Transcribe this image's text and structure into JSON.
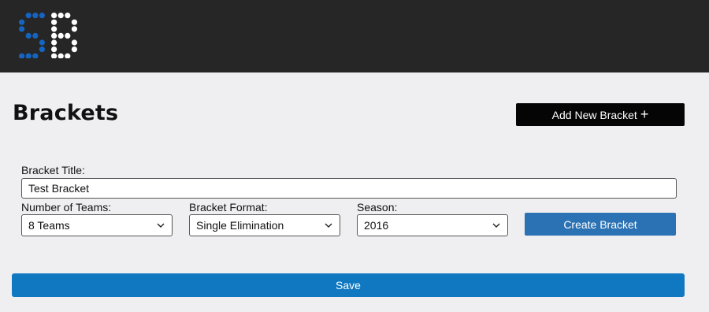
{
  "header": {
    "logo_icon": "sb-dot-matrix-logo-icon",
    "logo_text": "SB",
    "colors": {
      "background": "#262626",
      "logo_blue": "#1565c0",
      "logo_white": "#ffffff"
    }
  },
  "page": {
    "title": "Brackets"
  },
  "actions": {
    "add_new_label": "Add New Bracket",
    "add_new_icon": "plus-icon"
  },
  "form": {
    "title_label": "Bracket Title:",
    "title_value": "Test Bracket",
    "teams_label": "Number of Teams:",
    "teams_value": "8 Teams",
    "format_label": "Bracket Format:",
    "format_value": "Single Elimination",
    "season_label": "Season:",
    "season_value": "2016",
    "create_label": "Create Bracket"
  },
  "footer": {
    "save_label": "Save"
  },
  "colors": {
    "page_background": "#efeff1",
    "create_button": "#2b72b4",
    "save_button": "#0f78c1",
    "add_button": "#050505"
  }
}
